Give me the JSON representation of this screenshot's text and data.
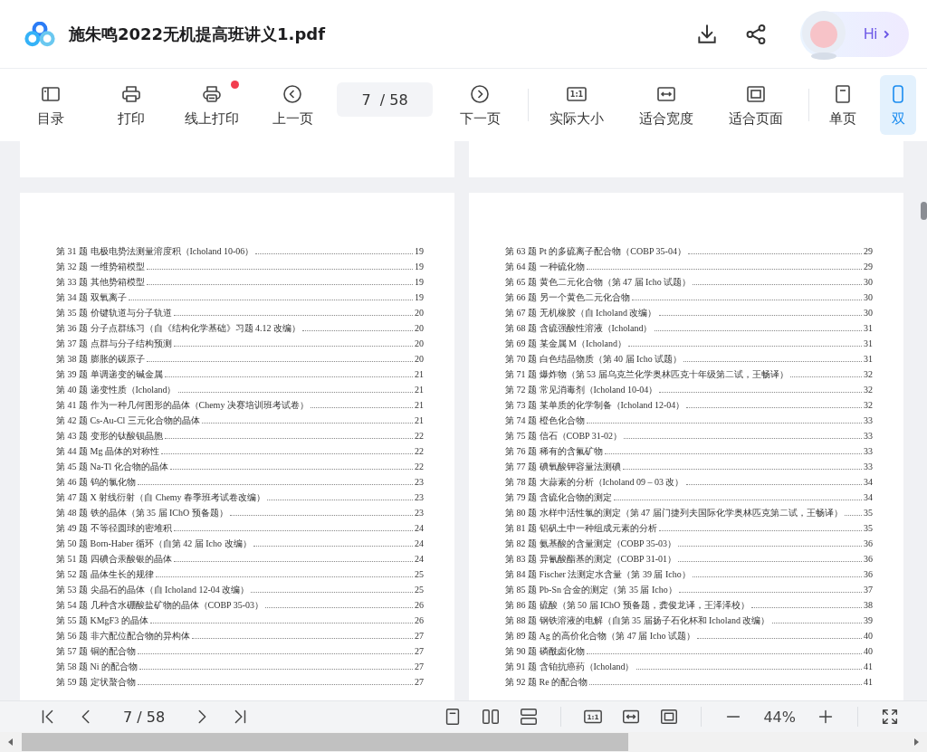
{
  "header": {
    "title": "施朱鸣2022无机提高班讲义1.pdf",
    "greeting": "Hi"
  },
  "toolbar": {
    "left_buttons": [
      {
        "label": "目录",
        "notification_dot": false
      },
      {
        "label": "打印",
        "notification_dot": false
      },
      {
        "label": "线上打印",
        "notification_dot": true
      },
      {
        "label": "上一页",
        "notification_dot": false
      }
    ],
    "page_field": {
      "value": "7",
      "total": "/ 58"
    },
    "next_button": {
      "label": "下一页"
    },
    "view_buttons": [
      {
        "label": "实际大小",
        "icon_text": "1:1"
      },
      {
        "label": "适合宽度"
      },
      {
        "label": "适合页面"
      }
    ],
    "mode_buttons": [
      {
        "label": "单页",
        "selected": false
      },
      {
        "label": "双",
        "selected": true
      }
    ]
  },
  "pages": [
    {
      "entries": [
        {
          "title": "第 31 题 电极电势法测量溶度积（Icholand 10-06）",
          "page": "19"
        },
        {
          "title": "第 32 题 一维势箱模型",
          "page": "19"
        },
        {
          "title": "第 33 题 其他势箱模型",
          "page": "19"
        },
        {
          "title": "第 34 题 双氧离子",
          "page": "19"
        },
        {
          "title": "第 35 题 价键轨道与分子轨道",
          "page": "20"
        },
        {
          "title": "第 36 题 分子点群练习（自《结构化学基础》习题 4.12 改编）",
          "page": "20"
        },
        {
          "title": "第 37 题 点群与分子结构预测",
          "page": "20"
        },
        {
          "title": "第 38 题 膨胀的碳原子",
          "page": "20"
        },
        {
          "title": "第 39 题 单调递变的碱金属",
          "page": "21"
        },
        {
          "title": "第 40 题 递变性质（Icholand）",
          "page": "21"
        },
        {
          "title": "第 41 题 作为一种几何图形的晶体（Chemy 决赛培训班考试卷）",
          "page": "21"
        },
        {
          "title": "第 42 题 Cs-Au-Cl 三元化合物的晶体",
          "page": "21"
        },
        {
          "title": "第 43 题 变形的钛酸钡晶胞",
          "page": "22"
        },
        {
          "title": "第 44 题 Mg 晶体的对称性",
          "page": "22"
        },
        {
          "title": "第 45 题 Na-Tl 化合物的晶体",
          "page": "22"
        },
        {
          "title": "第 46 题 钨的氯化物",
          "page": "23"
        },
        {
          "title": "第 47 题 X 射线衍射（自 Chemy 春季班考试卷改编）",
          "page": "23"
        },
        {
          "title": "第 48 题 铁的晶体（第 35 届 IChO 预备题）",
          "page": "23"
        },
        {
          "title": "第 49 题 不等径圆球的密堆积",
          "page": "24"
        },
        {
          "title": "第 50 题 Born-Haber 循环（自第 42 届 Icho 改编）",
          "page": "24"
        },
        {
          "title": "第 51 题 四碘合汞酸银的晶体",
          "page": "24"
        },
        {
          "title": "第 52 题 晶体生长的规律",
          "page": "25"
        },
        {
          "title": "第 53 题 尖晶石的晶体（自 Icholand 12-04 改编）",
          "page": "25"
        },
        {
          "title": "第 54 题 几种含水硼酸盐矿物的晶体（COBP 35-03）",
          "page": "26"
        },
        {
          "title": "第 55 题 KMgF3 的晶体",
          "page": "26"
        },
        {
          "title": "第 56 题 非六配位配合物的异构体",
          "page": "27"
        },
        {
          "title": "第 57 题 铜的配合物",
          "page": "27"
        },
        {
          "title": "第 58 题 Ni 的配合物",
          "page": "27"
        },
        {
          "title": "第 59 题 定状螯合物",
          "page": "27"
        }
      ]
    },
    {
      "entries": [
        {
          "title": "第 63 题 Pt 的多硫离子配合物（COBP 35-04）",
          "page": "29"
        },
        {
          "title": "第 64 题 一种硫化物",
          "page": "29"
        },
        {
          "title": "第 65 题 黄色二元化合物（第 47 届 Icho 试题）",
          "page": "30"
        },
        {
          "title": "第 66 题 另一个黄色二元化合物",
          "page": "30"
        },
        {
          "title": "第 67 题 无机橡胶（自 Icholand 改编）",
          "page": "30"
        },
        {
          "title": "第 68 题 含硫强酸性溶液（Icholand）",
          "page": "31"
        },
        {
          "title": "第 69 题 某金属 M（Icholand）",
          "page": "31"
        },
        {
          "title": "第 70 题 白色结晶物质（第 40 届 Icho 试题）",
          "page": "31"
        },
        {
          "title": "第 71 题 爆炸物（第 53 届乌克兰化学奥林匹克十年级第二试，王畅译）",
          "page": "32"
        },
        {
          "title": "第 72 题 常见消毒剂（Icholand 10-04）",
          "page": "32"
        },
        {
          "title": "第 73 题 某单质的化学制备（Icholand 12-04）",
          "page": "32"
        },
        {
          "title": "第 74 题 橙色化合物",
          "page": "33"
        },
        {
          "title": "第 75 题 信石（COBP 31-02）",
          "page": "33"
        },
        {
          "title": "第 76 题 稀有的含氟矿物",
          "page": "33"
        },
        {
          "title": "第 77 题 碘氧酸钾容量法测碘",
          "page": "33"
        },
        {
          "title": "第 78 题 大蒜素的分析（Icholand 09 – 03 改）",
          "page": "34"
        },
        {
          "title": "第 79 题 含硫化合物的测定",
          "page": "34"
        },
        {
          "title": "第 80 题 水样中活性氯的测定（第 47 届门捷列夫国际化学奥林匹克第二试，王畅译）",
          "page": "35"
        },
        {
          "title": "第 81 题 铝矾土中一种组成元素的分析",
          "page": "35"
        },
        {
          "title": "第 82 题 氨基酸的含量测定（COBP 35-03）",
          "page": "36"
        },
        {
          "title": "第 83 题 异氰酸酯基的测定（COBP 31-01）",
          "page": "36"
        },
        {
          "title": "第 84 题 Fischer 法测定水含量（第 39 届 Icho）",
          "page": "36"
        },
        {
          "title": "第 85 题 Pb-Sn 合金的测定（第 35 届 Icho）",
          "page": "37"
        },
        {
          "title": "第 86 题 硫酸（第 50 届 IChO 预备题，龚俊龙译，王泽泽校）",
          "page": "38"
        },
        {
          "title": "第 88 题 钢铁溶液的电解（自第 35 届扬子石化杯和 Icholand 改编）",
          "page": "39"
        },
        {
          "title": "第 89 题 Ag 的高价化合物（第 47 届 Icho 试题）",
          "page": "40"
        },
        {
          "title": "第 90 题 磷酰卤化物",
          "page": "40"
        },
        {
          "title": "第 91 题 含铂抗癌药（Icholand）",
          "page": "41"
        },
        {
          "title": "第 92 题 Re 的配合物",
          "page": "41"
        }
      ]
    }
  ],
  "bottom_bar": {
    "page_field": {
      "value": "7",
      "total": "/ 58"
    },
    "actual_size_text": "1:1",
    "zoom": "44%"
  }
}
